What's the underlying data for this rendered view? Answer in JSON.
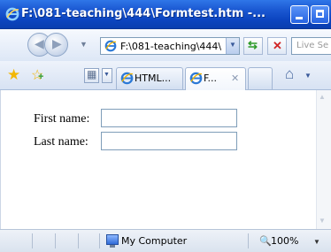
{
  "window": {
    "title": "F:\\081-teaching\\444\\Formtest.htm -..."
  },
  "navigation": {
    "address": "F:\\081-teaching\\444\\",
    "search_placeholder": "Live Se"
  },
  "tabs": [
    {
      "label": "HTML..."
    },
    {
      "label": "F...",
      "active": true
    }
  ],
  "form": {
    "fields": [
      {
        "label": "First name:",
        "value": ""
      },
      {
        "label": "Last name:",
        "value": ""
      }
    ]
  },
  "status": {
    "zone": "My Computer",
    "zoom": "100%"
  },
  "colors": {
    "titlebar": "#1b58d2",
    "address_border": "#7f9db9"
  },
  "icons": [
    "ie-logo-icon",
    "back-icon",
    "forward-icon",
    "refresh-icon",
    "stop-icon",
    "favorites-star-icon",
    "add-favorite-icon",
    "quick-tabs-icon",
    "home-icon",
    "computer-icon",
    "zoom-icon"
  ]
}
